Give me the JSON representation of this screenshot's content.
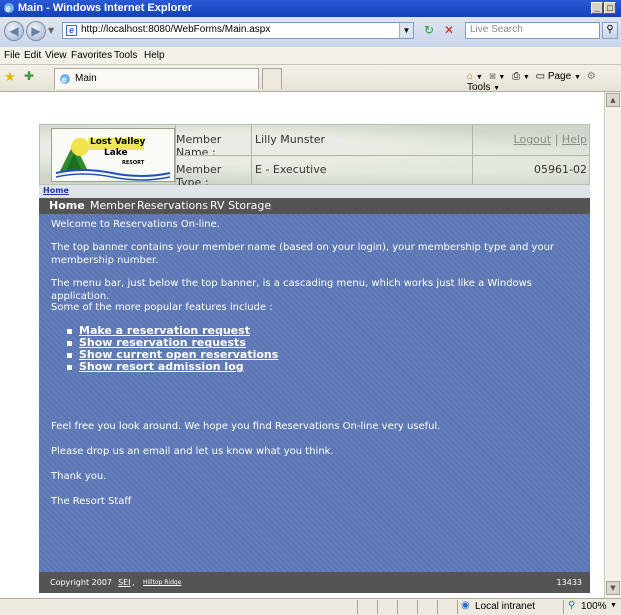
{
  "window": {
    "title": "Main - Windows Internet Explorer",
    "min": "_",
    "max": "□"
  },
  "addressbar": {
    "url": "http://localhost:8080/WebForms/Main.aspx",
    "search_placeholder": "Live Search"
  },
  "menubar": {
    "items": [
      "File",
      "Edit",
      "View",
      "Favorites",
      "Tools",
      "Help"
    ]
  },
  "tabs": {
    "active_tab": "Main",
    "page_menu": "Page",
    "tools_menu": "Tools"
  },
  "banner": {
    "logo_line1": "Lost Valley",
    "logo_line2": "Lake",
    "logo_line3": "RESORT",
    "member_name_label": "Member Name :",
    "member_name_value": "Lilly Munster",
    "member_type_label": "Member Type :",
    "member_type_value": "E - Executive",
    "logout": "Logout",
    "separator": "|",
    "help": "Help",
    "member_number": "05961-02"
  },
  "breadcrumb": {
    "home": "Home"
  },
  "topmenu": {
    "items": [
      "Home",
      "Member",
      "Reservations",
      "RV Storage"
    ]
  },
  "content": {
    "welcome": "Welcome to Reservations On-line.",
    "p1": "The top banner contains your member name (based on your login), your membership type and your membership number.",
    "p2": "The menu bar, just below the top banner, is a cascading menu, which works just like a Windows application.",
    "p3": "Some of the more popular features include :",
    "links": [
      "Make a reservation request",
      "Show reservation requests",
      "Show current open reservations",
      "Show resort admission log"
    ],
    "p4": "Feel free you look around. We hope you find Reservations On-line very useful.",
    "p5": "Please drop us an email and let us know what you think.",
    "p6": "Thank you.",
    "p7": "The Resort Staff"
  },
  "footer": {
    "copyright": "Copyright 2007",
    "sei": "SEI",
    "sep": ",",
    "hilltop": "Hilltop Ridge",
    "count": "13433"
  },
  "statusbar": {
    "zone": "Local intranet",
    "zoom": "100%"
  }
}
